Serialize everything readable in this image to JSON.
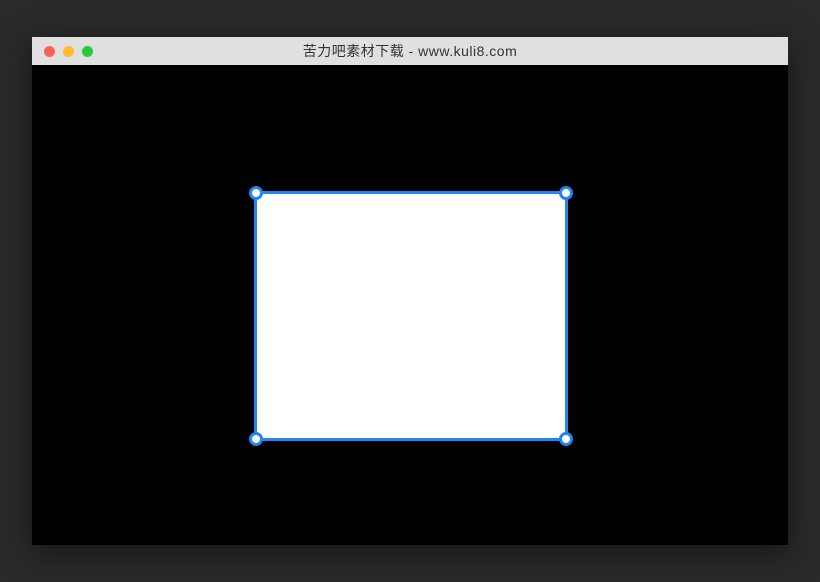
{
  "window": {
    "title": "苦力吧素材下载 - www.kuli8.com"
  },
  "selection": {
    "accent_color": "#2185f3",
    "fill_color": "#ffffff"
  }
}
